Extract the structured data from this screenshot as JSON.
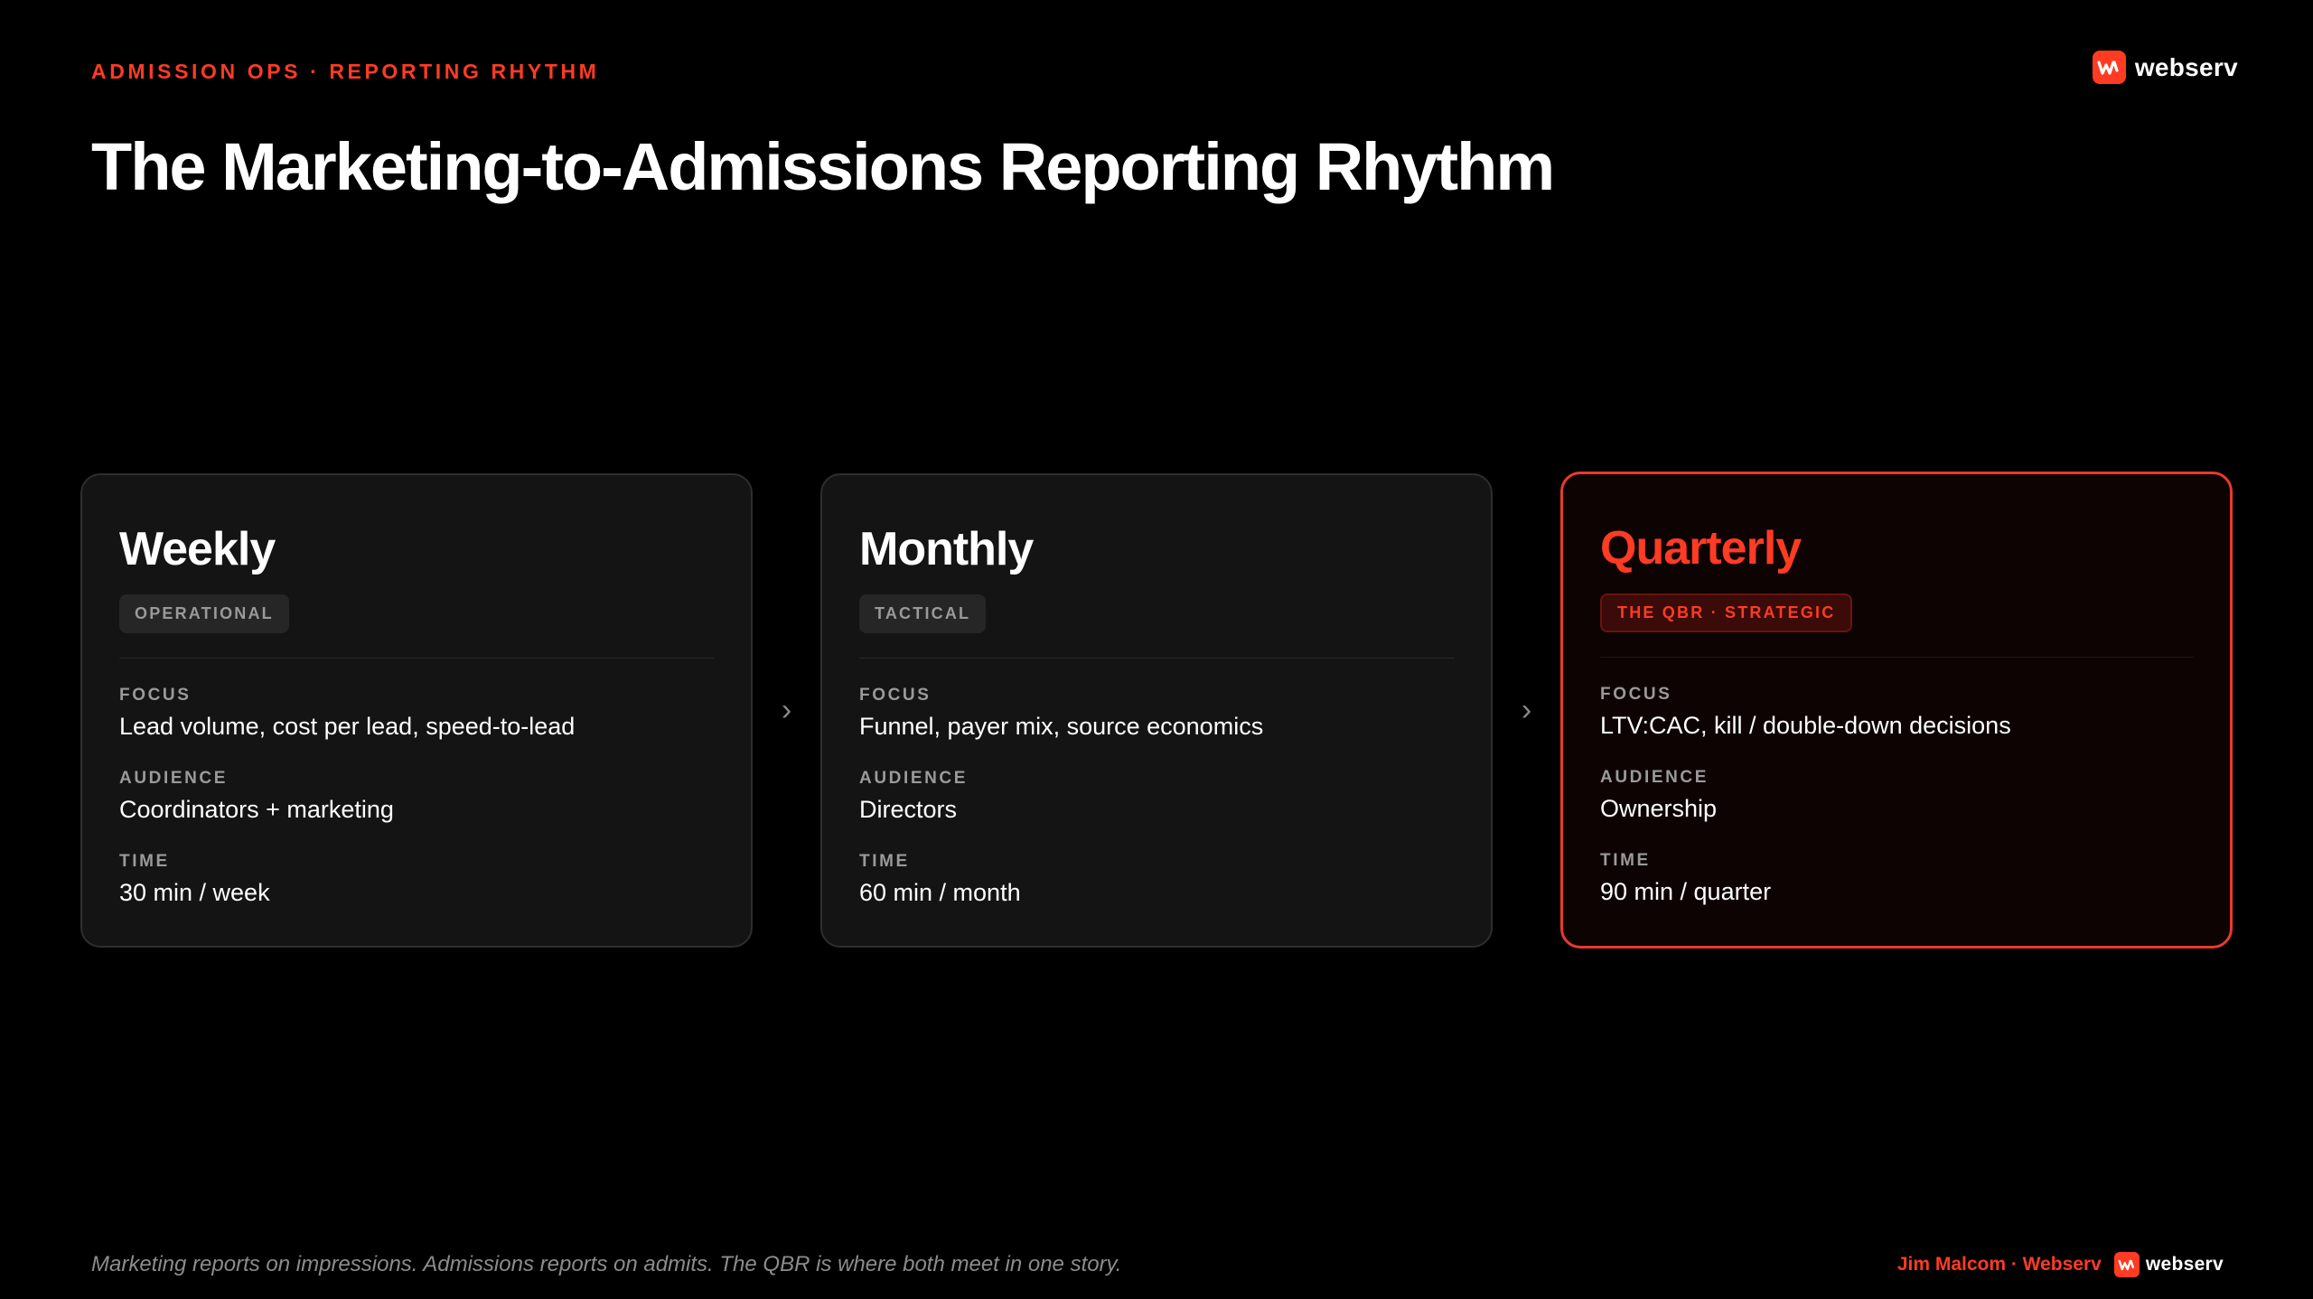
{
  "header": {
    "eyebrow": "ADMISSION OPS · REPORTING RHYTHM",
    "brand": "webserv",
    "logo_icon": "webserv-logo-icon"
  },
  "title": "The Marketing-to-Admissions Reporting Rhythm",
  "flow_arrow": "›",
  "cards": [
    {
      "title": "Weekly",
      "badge": "OPERATIONAL",
      "focus_label": "FOCUS",
      "focus": "Lead volume, cost per lead, speed-to-lead",
      "audience_label": "AUDIENCE",
      "audience": "Coordinators + marketing",
      "time_label": "TIME",
      "time": "30 min / week"
    },
    {
      "title": "Monthly",
      "badge": "TACTICAL",
      "focus_label": "FOCUS",
      "focus": "Funnel, payer mix, source economics",
      "audience_label": "AUDIENCE",
      "audience": "Directors",
      "time_label": "TIME",
      "time": "60 min / month"
    },
    {
      "title": "Quarterly",
      "badge": "THE QBR · STRATEGIC",
      "focus_label": "FOCUS",
      "focus": "LTV:CAC, kill / double-down decisions",
      "audience_label": "AUDIENCE",
      "audience": "Ownership",
      "time_label": "TIME",
      "time": "90 min / quarter",
      "highlighted": true
    }
  ],
  "footer": {
    "note": "Marketing reports on impressions. Admissions reports on admits. The QBR is where both meet in one story.",
    "author": "Jim Malcom · Webserv",
    "brand": "webserv"
  },
  "colors": {
    "accent": "#ff3b24",
    "background": "#000000",
    "card": "#141414",
    "highlight_card": "#0d0303"
  }
}
